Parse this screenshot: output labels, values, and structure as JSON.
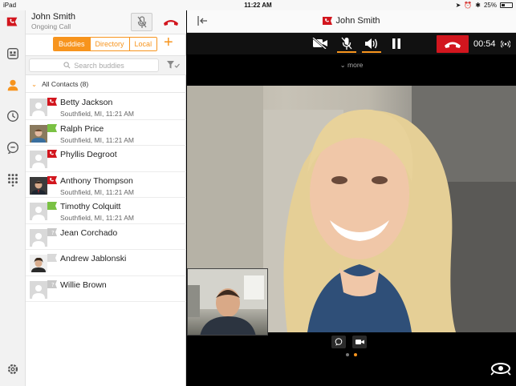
{
  "status_bar": {
    "device": "iPad",
    "time": "11:22 AM",
    "battery": "25%",
    "battery_level": 0.25
  },
  "call": {
    "caller": "John Smith",
    "status": "Ongoing Call",
    "timer": "00:54"
  },
  "tabs": [
    {
      "label": "Buddies",
      "active": true
    },
    {
      "label": "Directory",
      "active": false
    },
    {
      "label": "Local",
      "active": false
    }
  ],
  "search": {
    "placeholder": "Search buddies"
  },
  "group": {
    "label": "All Contacts (8)"
  },
  "contacts": [
    {
      "name": "Betty Jackson",
      "location": "Southfield, MI, 11:21 AM",
      "presence": "on-call",
      "avatar": "placeholder"
    },
    {
      "name": "Ralph Price",
      "location": "Southfield, MI, 11:21 AM",
      "presence": "available",
      "avatar": "photo"
    },
    {
      "name": "Phyllis Degroot",
      "location": "",
      "presence": "on-call",
      "avatar": "placeholder"
    },
    {
      "name": "Anthony Thompson",
      "location": "Southfield, MI, 11:21 AM",
      "presence": "on-call",
      "avatar": "photo"
    },
    {
      "name": "Timothy Colquitt",
      "location": "Southfield, MI, 11:21 AM",
      "presence": "available",
      "avatar": "placeholder"
    },
    {
      "name": "Jean Corchado",
      "location": "",
      "presence": "unknown",
      "avatar": "placeholder"
    },
    {
      "name": "Andrew Jablonski",
      "location": "",
      "presence": "offline",
      "avatar": "photo"
    },
    {
      "name": "Willie Brown",
      "location": "",
      "presence": "unknown",
      "avatar": "placeholder"
    }
  ],
  "controls": {
    "more_label": "more"
  },
  "page_indicator": {
    "pages": 2,
    "active": 2
  },
  "colors": {
    "accent": "#f7941d",
    "end_call": "#d2161e",
    "available": "#7ac143",
    "on_call": "#d2161e",
    "unknown": "#c8c8c8"
  }
}
